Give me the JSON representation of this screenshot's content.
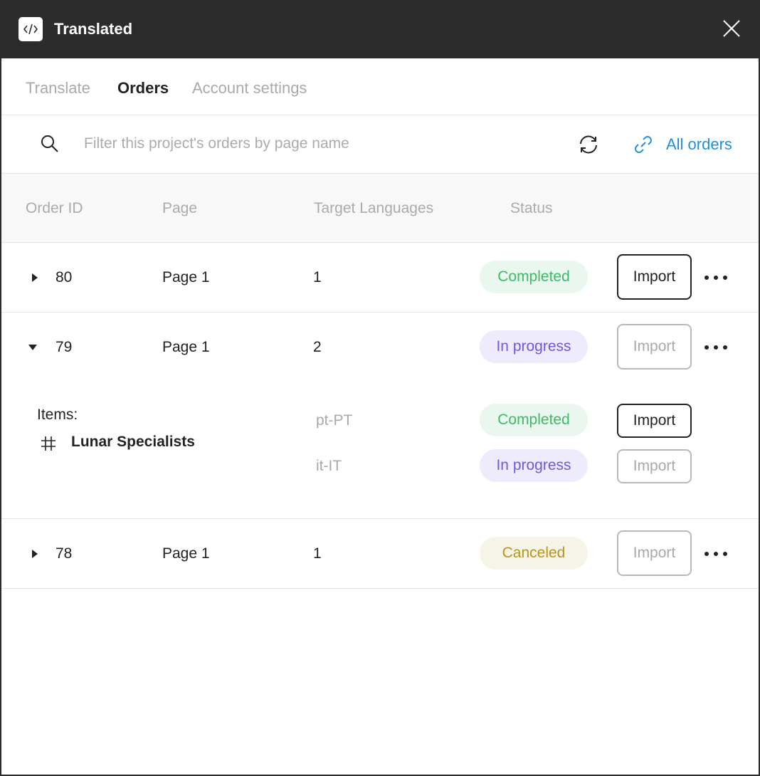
{
  "app": {
    "title": "Translated"
  },
  "tabs": [
    {
      "label": "Translate",
      "active": false
    },
    {
      "label": "Orders",
      "active": true
    },
    {
      "label": "Account settings",
      "active": false
    }
  ],
  "search": {
    "placeholder": "Filter this project's orders by page name",
    "value": ""
  },
  "toolbar": {
    "all_orders_label": "All orders"
  },
  "table": {
    "headers": [
      "Order ID",
      "Page",
      "Target Languages",
      "Status"
    ],
    "rows": [
      {
        "id": "80",
        "page": "Page 1",
        "languages": "1",
        "status": "Completed",
        "import_label": "Import",
        "import_enabled": true,
        "expanded": false
      },
      {
        "id": "79",
        "page": "Page 1",
        "languages": "2",
        "status": "In progress",
        "import_label": "Import",
        "import_enabled": false,
        "expanded": true,
        "details": {
          "items_label": "Items:",
          "item_name": "Lunar Specialists",
          "languages": [
            {
              "code": "pt-PT",
              "status": "Completed",
              "import_label": "Import",
              "import_enabled": true
            },
            {
              "code": "it-IT",
              "status": "In progress",
              "import_label": "Import",
              "import_enabled": false
            }
          ]
        }
      },
      {
        "id": "78",
        "page": "Page 1",
        "languages": "1",
        "status": "Canceled",
        "import_label": "Import",
        "import_enabled": false,
        "expanded": false
      }
    ]
  },
  "colors": {
    "titlebar": "#2c2c2c",
    "link": "#1d8fe0",
    "completed": "#3fb968",
    "in_progress": "#6e58e0",
    "canceled": "#b5941f"
  },
  "icons": [
    "code-icon",
    "close-icon",
    "search-icon",
    "refresh-icon",
    "link-icon",
    "caret-right-icon",
    "caret-down-icon",
    "hash-icon",
    "more-icon"
  ]
}
